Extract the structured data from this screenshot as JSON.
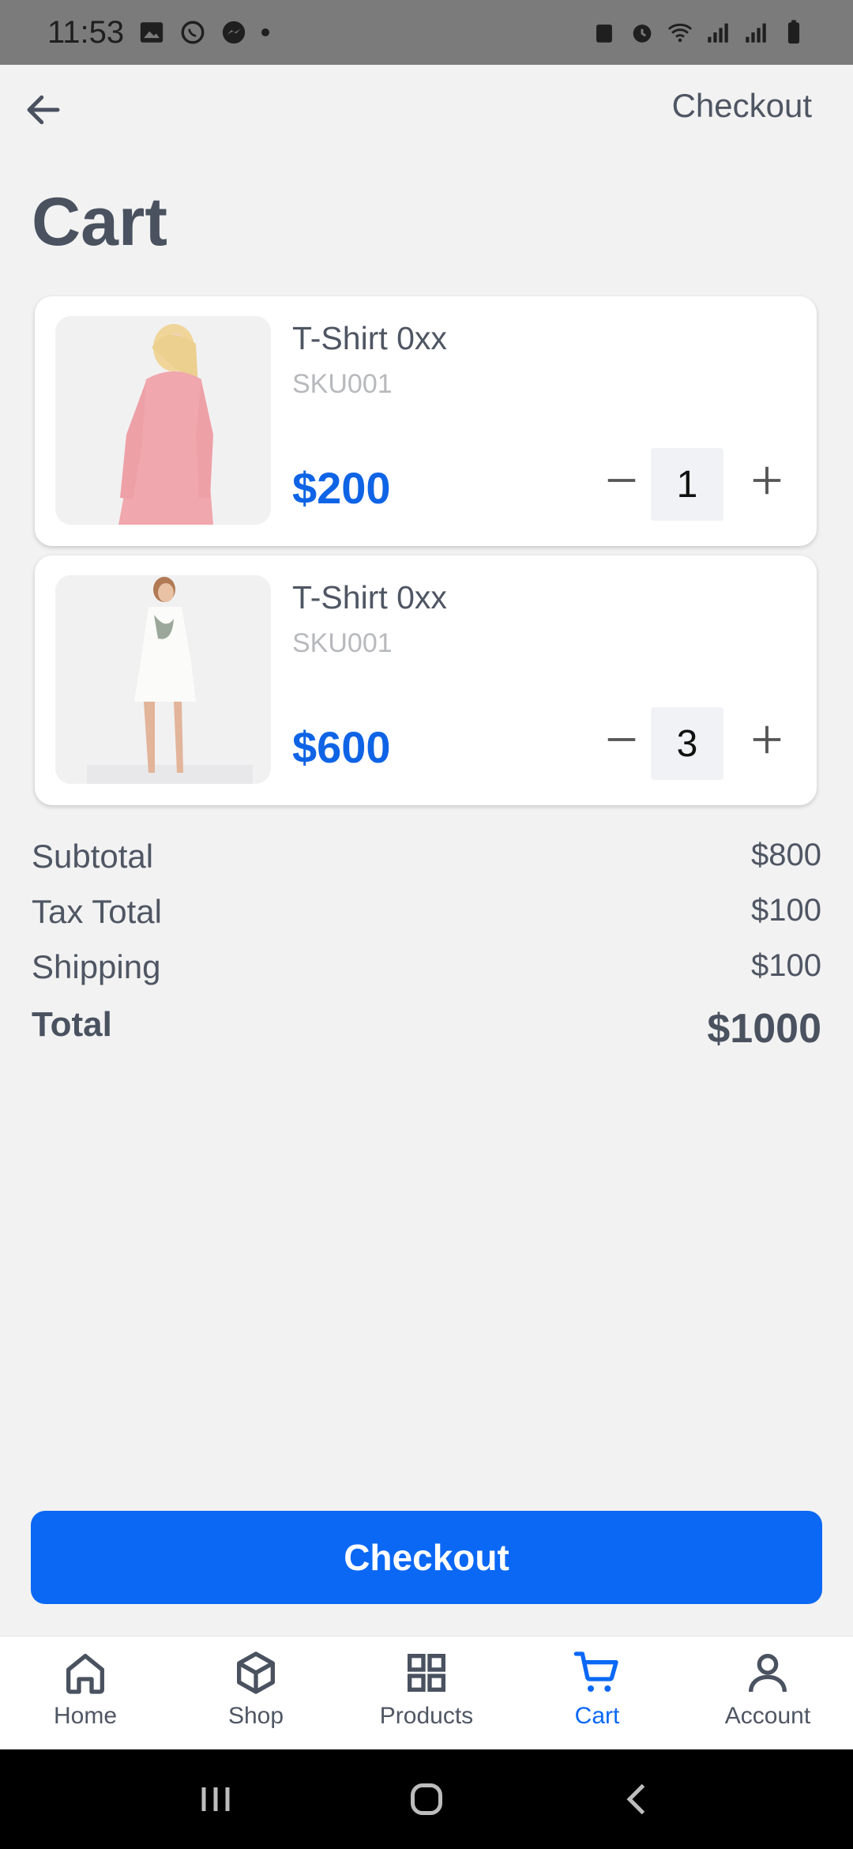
{
  "status_bar": {
    "time": "11:53"
  },
  "topbar": {
    "action_label": "Checkout"
  },
  "page": {
    "title": "Cart"
  },
  "cart_items": [
    {
      "name": "T-Shirt 0xx",
      "sku": "SKU001",
      "price": "$200",
      "qty": "1",
      "image": "pink-dress"
    },
    {
      "name": "T-Shirt 0xx",
      "sku": "SKU001",
      "price": "$600",
      "qty": "3",
      "image": "white-dress"
    }
  ],
  "summary": {
    "subtotal_label": "Subtotal",
    "subtotal_value": "$800",
    "tax_label": "Tax Total",
    "tax_value": "$100",
    "shipping_label": "Shipping",
    "shipping_value": "$100",
    "total_label": "Total",
    "total_value": "$1000"
  },
  "checkout_button": {
    "label": "Checkout"
  },
  "bottom_nav": {
    "items": [
      {
        "label": "Home",
        "icon": "home-icon"
      },
      {
        "label": "Shop",
        "icon": "box-icon"
      },
      {
        "label": "Products",
        "icon": "grid-icon"
      },
      {
        "label": "Cart",
        "icon": "cart-icon",
        "active": true
      },
      {
        "label": "Account",
        "icon": "user-icon"
      }
    ]
  },
  "colors": {
    "accent": "#0a68f5",
    "text": "#4a5260",
    "background": "#f2f2f2"
  }
}
